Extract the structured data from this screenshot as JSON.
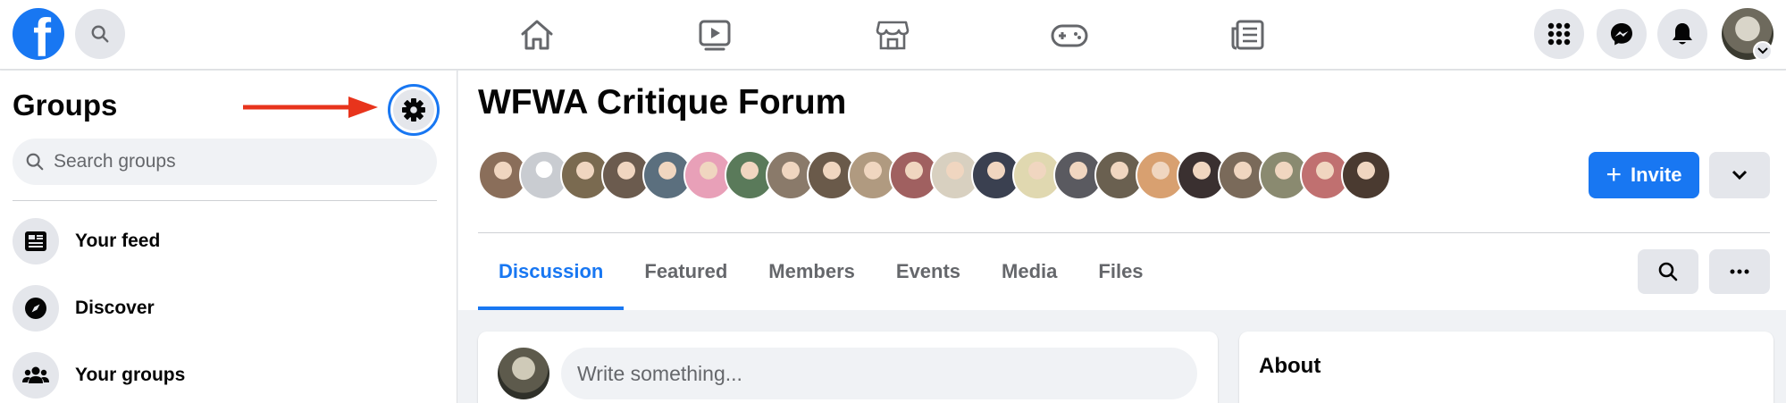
{
  "topbar": {
    "logo_letter": "f",
    "nav_icons": [
      "home-icon",
      "watch-icon",
      "marketplace-icon",
      "gaming-icon",
      "news-icon"
    ],
    "right_icons": [
      "menu-grid-icon",
      "messenger-icon",
      "notifications-icon"
    ]
  },
  "sidebar": {
    "title": "Groups",
    "search_placeholder": "Search groups",
    "items": [
      {
        "label": "Your feed",
        "icon": "feed-icon"
      },
      {
        "label": "Discover",
        "icon": "compass-icon"
      },
      {
        "label": "Your groups",
        "icon": "groups-icon"
      }
    ],
    "annotation": "red arrow pointing to settings gear"
  },
  "group": {
    "name": "WFWA Critique Forum",
    "member_avatar_colors": [
      "#8a6e5a",
      "#c9ccd1",
      "#7a6a50",
      "#6b5b4e",
      "#5b6f7e",
      "#e8a0b8",
      "#5a7a5a",
      "#8a7a6a",
      "#6a5a4a",
      "#b09a80",
      "#a06060",
      "#d8d0c0",
      "#3a4050",
      "#e0d8b0",
      "#5a5a60",
      "#6a6050",
      "#d8a070",
      "#3a3030",
      "#7a6a5a",
      "#8a8a70",
      "#c07070",
      "#4a3a30"
    ],
    "invite_label": "Invite",
    "tabs": [
      "Discussion",
      "Featured",
      "Members",
      "Events",
      "Media",
      "Files"
    ],
    "active_tab": "Discussion"
  },
  "composer": {
    "placeholder": "Write something..."
  },
  "about": {
    "title": "About"
  },
  "colors": {
    "accent": "#1877f2",
    "arrow": "#e8341c"
  }
}
